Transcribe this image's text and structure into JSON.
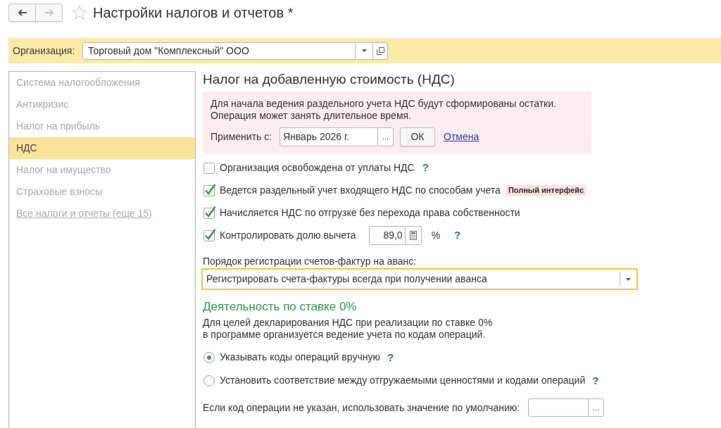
{
  "navigation": [
    {
      "kind": "back",
      "disabled": false
    },
    {
      "kind": "forward",
      "disabled": true
    }
  ],
  "window": {
    "title": "Настройки налогов и отчетов *",
    "favorite": false
  },
  "organization": {
    "label": "Организация:",
    "value": "Торговый дом \"Комплексный\" ООО"
  },
  "sidebar": {
    "items": [
      {
        "label": "Система налогообложения",
        "kind": "section",
        "selected": false
      },
      {
        "label": "Антикризис",
        "kind": "section",
        "selected": false
      },
      {
        "label": "Налог на прибыль",
        "kind": "section",
        "selected": false
      },
      {
        "label": "НДС",
        "kind": "section",
        "selected": true
      },
      {
        "label": "Налог на имущество",
        "kind": "section",
        "selected": false
      },
      {
        "label": "Страховые взносы",
        "kind": "section",
        "selected": false
      },
      {
        "label": "Все налоги и отчеты (еще 15)",
        "kind": "link",
        "selected": false
      }
    ]
  },
  "vat": {
    "title": "Налог на добавленную стоимость (НДС)",
    "notice": {
      "lines": [
        "Для начала ведения раздельного учета НДС будут сформированы остатки.",
        "Операция может занять длительное время."
      ],
      "apply_label": "Применить с:",
      "apply_value": "Январь 2026 г.",
      "select_button": "...",
      "ok_button": "ОК",
      "cancel_link": "Отмена"
    },
    "options": [
      {
        "kind": "checkbox",
        "label": "Организация освобождена от уплаты НДС",
        "checked": false,
        "help": "?"
      },
      {
        "kind": "checkbox",
        "label": "Ведется раздельный учет входящего НДС по способам учета",
        "checked": true,
        "badge": "Полный интерфейс"
      },
      {
        "kind": "checkbox",
        "label": "Начисляется НДС по отгрузке без перехода права собственности",
        "checked": true
      },
      {
        "kind": "checkbox",
        "label": "Контролировать долю вычета",
        "checked": true,
        "value": "89,0",
        "unit": "%",
        "help": "?"
      }
    ],
    "invoice_order": {
      "label": "Порядок регистрации счетов-фактур на аванс:",
      "value": "Регистрировать счета-фактуры всегда при получении аванса",
      "focused": true
    }
  },
  "zero_rate": {
    "title": "Деятельность по ставке 0%",
    "description_lines": [
      "Для целей декларирования НДС при реализации по ставке 0%",
      "в программе организуется ведение учета по кодам операций."
    ],
    "modes": [
      {
        "label": "Указывать коды операций вручную",
        "selected": true,
        "help": "?"
      },
      {
        "label": "Установить соответствие между отгружаемыми ценностями и кодами операций",
        "selected": false,
        "help": "?"
      }
    ],
    "default_code": {
      "label": "Если код операции не указан, использовать значение по умолчанию:",
      "select_button": "..."
    }
  }
}
